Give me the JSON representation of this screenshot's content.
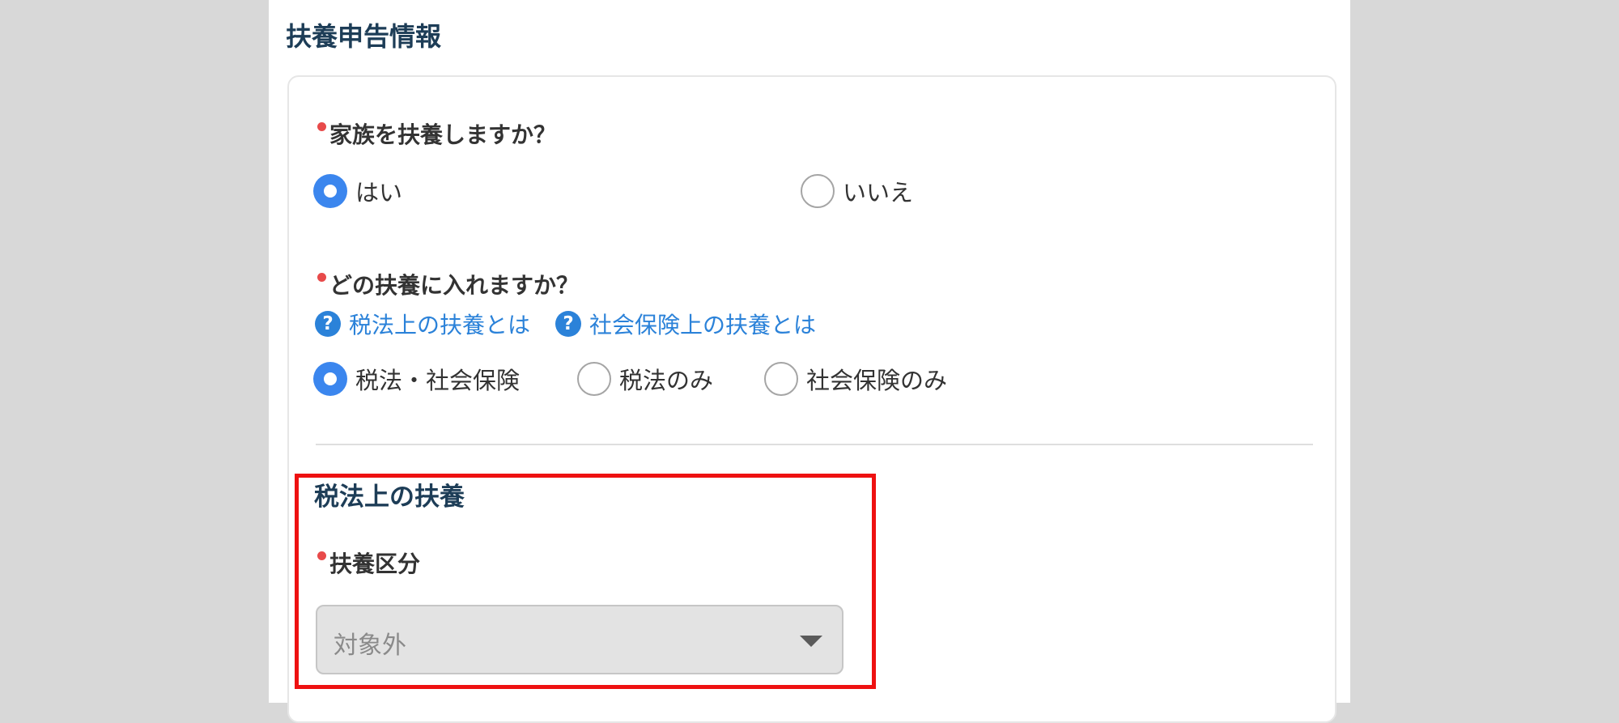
{
  "section": {
    "title": "扶養申告情報"
  },
  "q1": {
    "label": "家族を扶養しますか？",
    "options": [
      {
        "label": "はい",
        "checked": true
      },
      {
        "label": "いいえ",
        "checked": false
      }
    ]
  },
  "q2": {
    "label": "どの扶養に入れますか？",
    "help_links": [
      {
        "icon": "question-circle-icon",
        "text": "税法上の扶養とは"
      },
      {
        "icon": "question-circle-icon",
        "text": "社会保険上の扶養とは"
      }
    ],
    "options": [
      {
        "label": "税法・社会保険",
        "checked": true
      },
      {
        "label": "税法のみ",
        "checked": false
      },
      {
        "label": "社会保険のみ",
        "checked": false
      }
    ]
  },
  "tax_section": {
    "title": "税法上の扶養",
    "field_label": "扶養区分",
    "select_value": "対象外",
    "select_icon": "caret-down-icon"
  },
  "colors": {
    "accent": "#3b86ee",
    "link": "#2b82d9",
    "required": "#e84a4a",
    "highlight": "#ee1111",
    "heading": "#1d3d57"
  }
}
